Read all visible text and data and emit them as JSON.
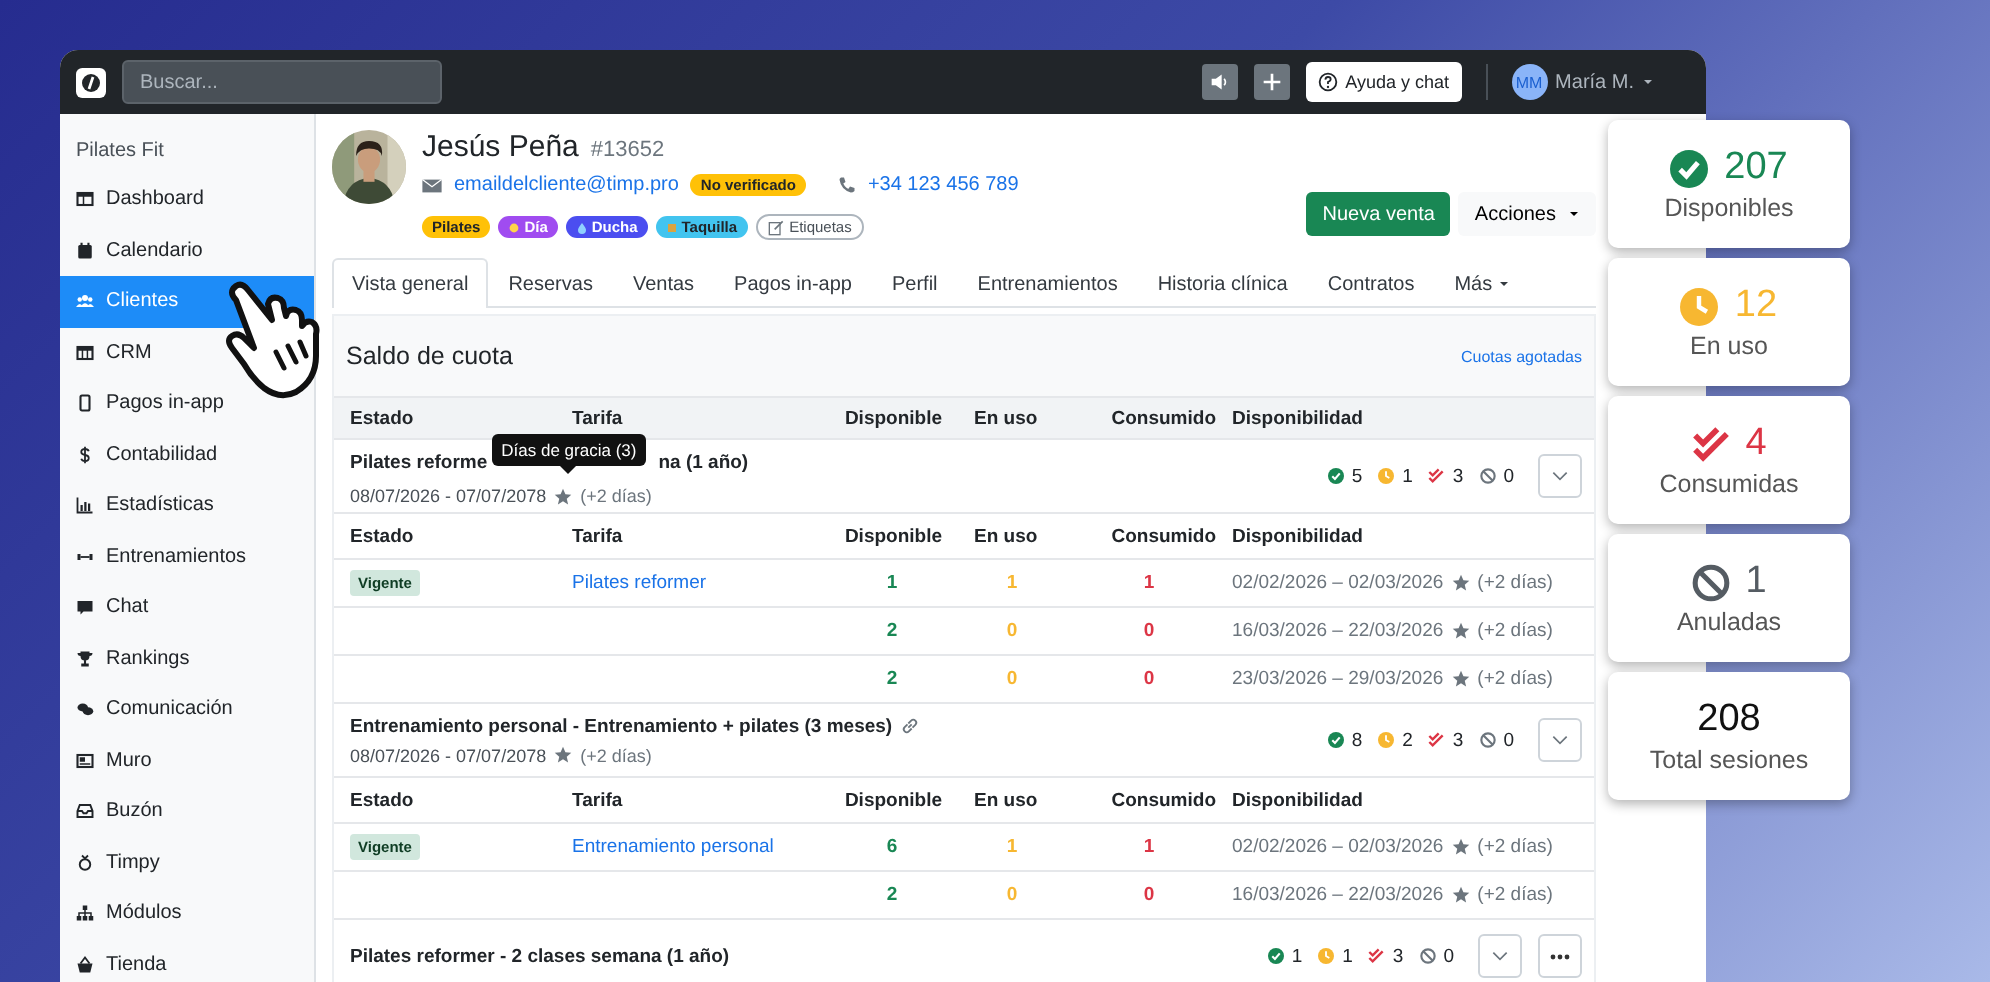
{
  "topbar": {
    "search_placeholder": "Buscar...",
    "help_button": "Ayuda y chat",
    "user_initials": "MM",
    "user_name": "María M."
  },
  "sidebar": {
    "title": "Pilates Fit",
    "items": [
      {
        "label": "Dashboard",
        "selected": false
      },
      {
        "label": "Calendario",
        "selected": false
      },
      {
        "label": "Clientes",
        "selected": true
      },
      {
        "label": "CRM",
        "selected": false
      },
      {
        "label": "Pagos in-app",
        "selected": false
      },
      {
        "label": "Contabilidad",
        "selected": false
      },
      {
        "label": "Estadísticas",
        "selected": false
      },
      {
        "label": "Entrenamientos",
        "selected": false
      },
      {
        "label": "Chat",
        "selected": false
      },
      {
        "label": "Rankings",
        "selected": false
      },
      {
        "label": "Comunicación",
        "selected": false
      },
      {
        "label": "Muro",
        "selected": false
      },
      {
        "label": "Buzón",
        "selected": false
      },
      {
        "label": "Timpy",
        "selected": false
      },
      {
        "label": "Módulos",
        "selected": false
      },
      {
        "label": "Tienda",
        "selected": false
      }
    ]
  },
  "client": {
    "name": "Jesús Peña",
    "id": "#13652",
    "email": "emaildelcliente@timp.pro",
    "email_badge": "No verificado",
    "phone": "+34 123 456 789",
    "tags": [
      {
        "label": "Pilates",
        "color": "#ffc107"
      },
      {
        "label": "Día",
        "color": "#a04cf0"
      },
      {
        "label": "Ducha",
        "color": "#4b4ef0"
      },
      {
        "label": "Taquilla",
        "color": "#42c4ef"
      }
    ],
    "tags_button": "Etiquetas"
  },
  "actions": {
    "primary": "Nueva venta",
    "menu": "Acciones"
  },
  "tabs": [
    {
      "label": "Vista general",
      "selected": true
    },
    {
      "label": "Reservas",
      "selected": false
    },
    {
      "label": "Ventas",
      "selected": false
    },
    {
      "label": "Pagos in-app",
      "selected": false
    },
    {
      "label": "Perfil",
      "selected": false
    },
    {
      "label": "Entrenamientos",
      "selected": false
    },
    {
      "label": "Historia clínica",
      "selected": false
    },
    {
      "label": "Contratos",
      "selected": false
    },
    {
      "label": "Más",
      "selected": false
    }
  ],
  "quota": {
    "title": "Saldo de cuota",
    "link": "Cuotas agotadas",
    "columns": [
      "Estado",
      "Tarifa",
      "Disponible",
      "En uso",
      "Consumido",
      "Disponibilidad"
    ],
    "groups": [
      {
        "title": "Pilates reforme",
        "tooltip": "Días de gracia (3)",
        "title_end": "na (1 año)",
        "linked": false,
        "dates": "08/07/2026 - 07/07/2078",
        "grace": "(+2 días)",
        "available": "5",
        "in_use": "1",
        "consumed": "3",
        "cancelled": "0",
        "more_button": false,
        "columns": [
          "Estado",
          "Tarifa",
          "Disponible",
          "En uso",
          "Consumido",
          "Disponibilidad"
        ],
        "rows": [
          {
            "status": "Vigente",
            "tariff": "Pilates reformer",
            "available": "1",
            "in_use": "1",
            "consumed": "1",
            "period": "02/02/2026 – 02/03/2026",
            "grace": "(+2 días)"
          },
          {
            "available": "2",
            "in_use": "0",
            "consumed": "0",
            "period": "16/03/2026 – 22/03/2026",
            "grace": "(+2 días)"
          },
          {
            "available": "2",
            "in_use": "0",
            "consumed": "0",
            "period": "23/03/2026 – 29/03/2026",
            "grace": "(+2 días)"
          }
        ]
      },
      {
        "title": "Entrenamiento personal - Entrenamiento + pilates (3 meses)",
        "linked": true,
        "dates": "08/07/2026 - 07/07/2078",
        "grace": "(+2 días)",
        "available": "8",
        "in_use": "2",
        "consumed": "3",
        "cancelled": "0",
        "more_button": false,
        "columns": [
          "Estado",
          "Tarifa",
          "Disponible",
          "En uso",
          "Consumido",
          "Disponibilidad"
        ],
        "rows": [
          {
            "status": "Vigente",
            "tariff": "Entrenamiento personal",
            "available": "6",
            "in_use": "1",
            "consumed": "1",
            "period": "02/02/2026 – 02/03/2026",
            "grace": "(+2 días)"
          },
          {
            "available": "2",
            "in_use": "0",
            "consumed": "0",
            "period": "16/03/2026 – 22/03/2026",
            "grace": "(+2 días)"
          }
        ]
      },
      {
        "title": "Pilates reformer - 2 clases semana (1 año)",
        "linked": false,
        "available": "1",
        "in_use": "1",
        "consumed": "3",
        "cancelled": "0",
        "more_button": true
      }
    ]
  },
  "stats": [
    {
      "kind": "available",
      "value": "207",
      "label": "Disponibles"
    },
    {
      "kind": "in_use",
      "value": "12",
      "label": "En uso"
    },
    {
      "kind": "consumed",
      "value": "4",
      "label": "Consumidas"
    },
    {
      "kind": "cancelled",
      "value": "1",
      "label": "Anuladas"
    },
    {
      "kind": "total",
      "value": "208",
      "label": "Total sesiones"
    }
  ]
}
